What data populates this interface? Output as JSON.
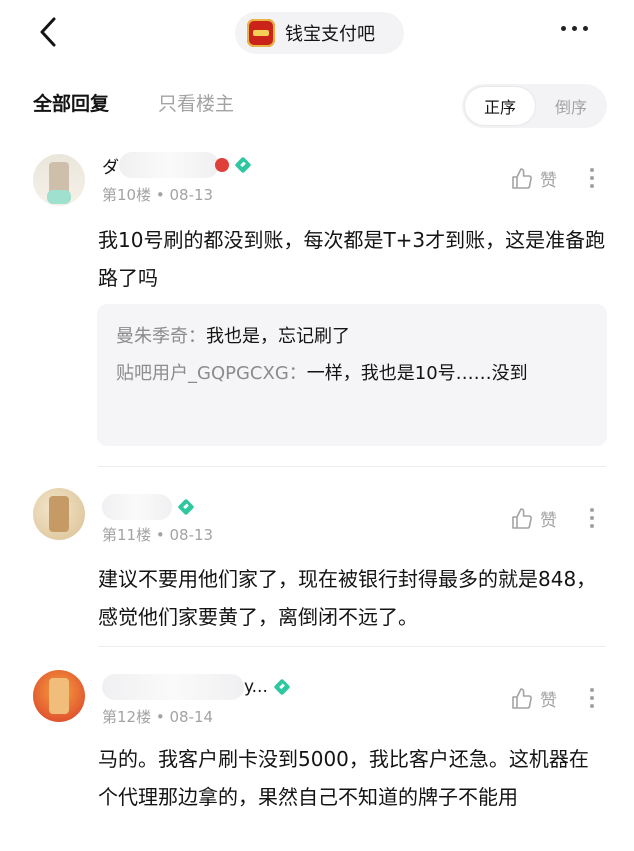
{
  "header": {
    "forum_name": "钱宝支付吧",
    "back_icon": "chevron-left-icon",
    "more_icon": "more-horizontal-icon"
  },
  "tabs": {
    "all_replies": "全部回复",
    "op_only": "只看楼主",
    "order_asc": "正序",
    "order_desc": "倒序"
  },
  "posts": [
    {
      "username_visible": "ダ",
      "floor": "第10楼",
      "date": "08-13",
      "like_label": "赞",
      "text": "我10号刷的都没到账，每次都是T+3才到账，这是准备跑路了吗",
      "replies": [
        {
          "user": "曼朱季奇：",
          "text": "我也是，忘记刷了"
        },
        {
          "user": "贴吧用户_GQPGCXG：",
          "text": "一样，我也是10号……没到"
        }
      ]
    },
    {
      "username_visible": "",
      "floor": "第11楼",
      "date": "08-13",
      "like_label": "赞",
      "text": "建议不要用他们家了，现在被银行封得最多的就是848，感觉他们家要黄了，离倒闭不远了。",
      "replies": []
    },
    {
      "username_visible": "y...",
      "floor": "第12楼",
      "date": "08-14",
      "like_label": "赞",
      "text": "马的。我客户刷卡没到5000，我比客户还急。这机器在个代理那边拿的，果然自己不知道的牌子不能用",
      "replies": []
    }
  ],
  "colors": {
    "accent_badge": "#2ec7a0",
    "muted_text": "#a3a3a3",
    "reply_bg": "#f5f5f7"
  }
}
